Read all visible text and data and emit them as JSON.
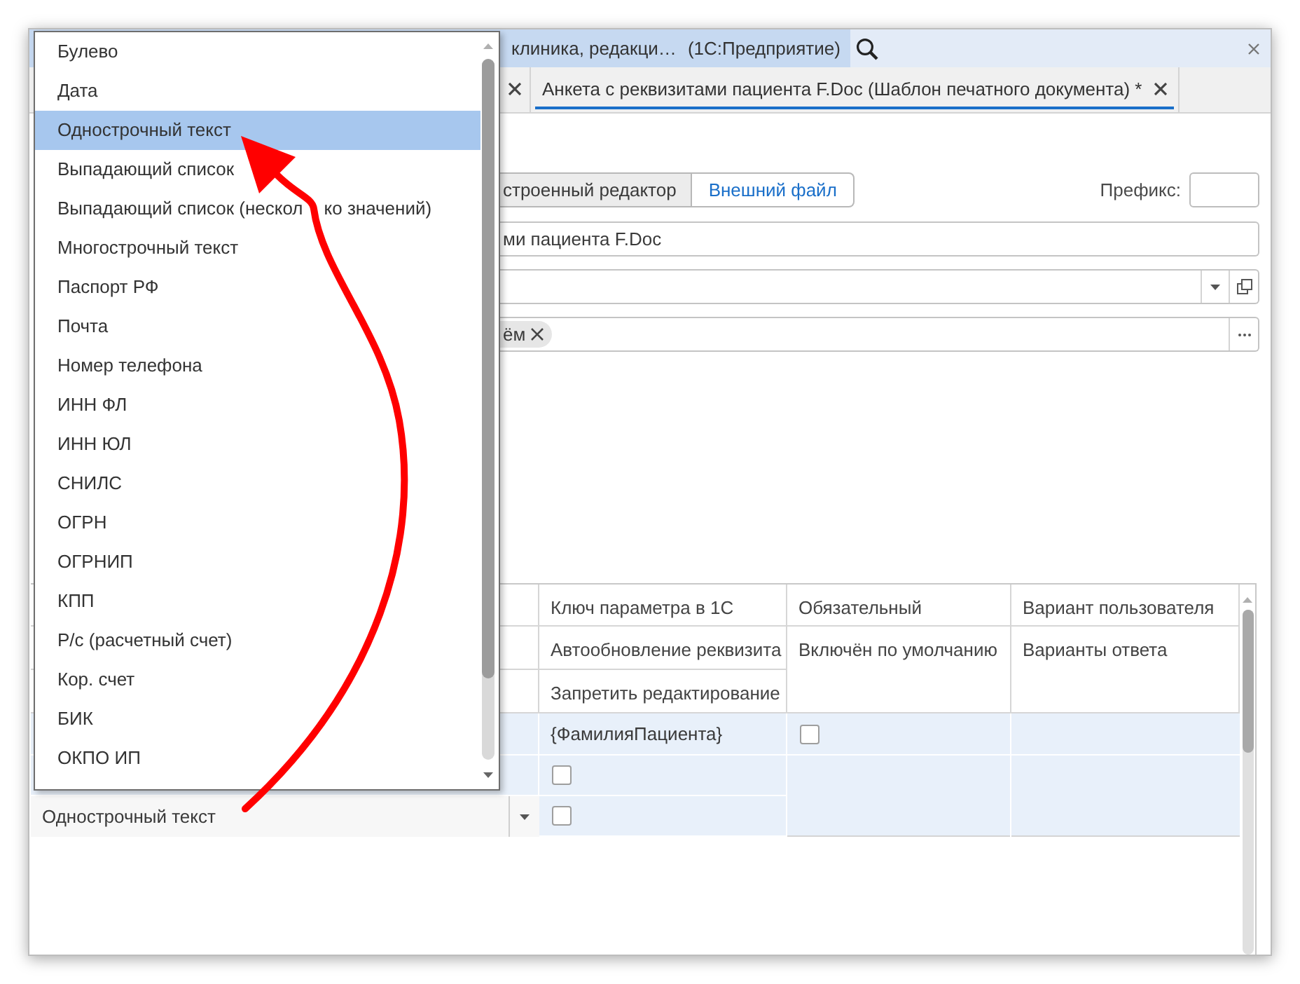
{
  "window": {
    "title": "клиника, редакци…",
    "app_name": "(1С:Предприятие)"
  },
  "tabs": [
    {
      "selected": false
    },
    {
      "label": "Анкета с реквизитами пациента F.Doc (Шаблон печатного документа) *",
      "selected": true
    }
  ],
  "editor_mode": [
    {
      "label": "строенный редактор",
      "selected": true
    },
    {
      "label": "Внешний файл",
      "selected": false
    }
  ],
  "prefix_field": {
    "label": "Префикс:"
  },
  "name_field": {
    "value": "ми пациента F.Doc"
  },
  "tags_field": {
    "tags": [
      {
        "label": "ём"
      }
    ]
  },
  "table": {
    "header_rows": [
      [
        "Ключ параметра в 1С",
        "Обязательный",
        "Вариант пользователя"
      ],
      [
        "Автообновление реквизита",
        "Включён по умолчанию",
        "Варианты ответа"
      ],
      [
        "Запретить редактирование"
      ]
    ],
    "rows": [
      {
        "selected": true,
        "key": "{ФамилияПациента}",
        "required": false,
        "auto_update": false,
        "no_edit": false,
        "field_type": "Однострочный текст"
      }
    ]
  },
  "dropdown": {
    "items": [
      {
        "label": "Булево",
        "selected": false
      },
      {
        "label": "Дата",
        "selected": false
      },
      {
        "label": "Однострочный текст",
        "selected": true
      },
      {
        "label": "Выпадающий список",
        "selected": false
      },
      {
        "label": "Выпадающий список (нескол",
        "label_after_arrow": "ко значений)",
        "selected": false
      },
      {
        "label": "Многострочный текст",
        "selected": false
      },
      {
        "label": "Паспорт РФ",
        "selected": false
      },
      {
        "label": "Почта",
        "selected": false
      },
      {
        "label": "Номер телефона",
        "selected": false
      },
      {
        "label": "ИНН ФЛ",
        "selected": false
      },
      {
        "label": "ИНН ЮЛ",
        "selected": false
      },
      {
        "label": "СНИЛС",
        "selected": false
      },
      {
        "label": "ОГРН",
        "selected": false
      },
      {
        "label": "ОГРНИП",
        "selected": false
      },
      {
        "label": "КПП",
        "selected": false
      },
      {
        "label": "Р/с (расчетный счет)",
        "selected": false
      },
      {
        "label": "Кор. счет",
        "selected": false
      },
      {
        "label": "БИК",
        "selected": false
      },
      {
        "label": "ОКПО ИП",
        "selected": false
      }
    ]
  }
}
